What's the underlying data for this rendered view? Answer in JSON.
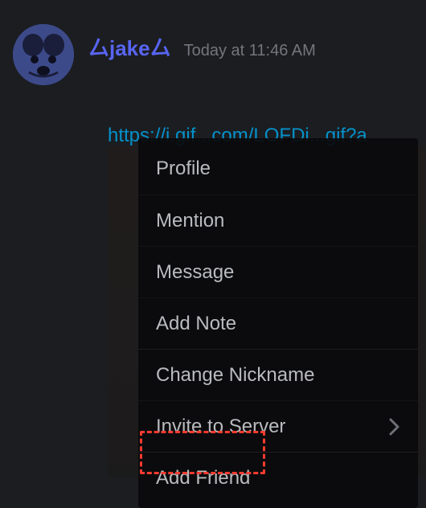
{
  "message": {
    "username": "厶jake厶",
    "timestamp": "Today at 11:46 AM",
    "link_text": "https://i.gif...com/LOFDi...gif?a"
  },
  "menu": {
    "items": [
      {
        "label": "Profile"
      },
      {
        "label": "Mention"
      },
      {
        "label": "Message"
      },
      {
        "label": "Add Note"
      },
      {
        "label": "Change Nickname"
      },
      {
        "label": "Invite to Server",
        "submenu": true
      },
      {
        "label": "Add Friend"
      }
    ]
  }
}
